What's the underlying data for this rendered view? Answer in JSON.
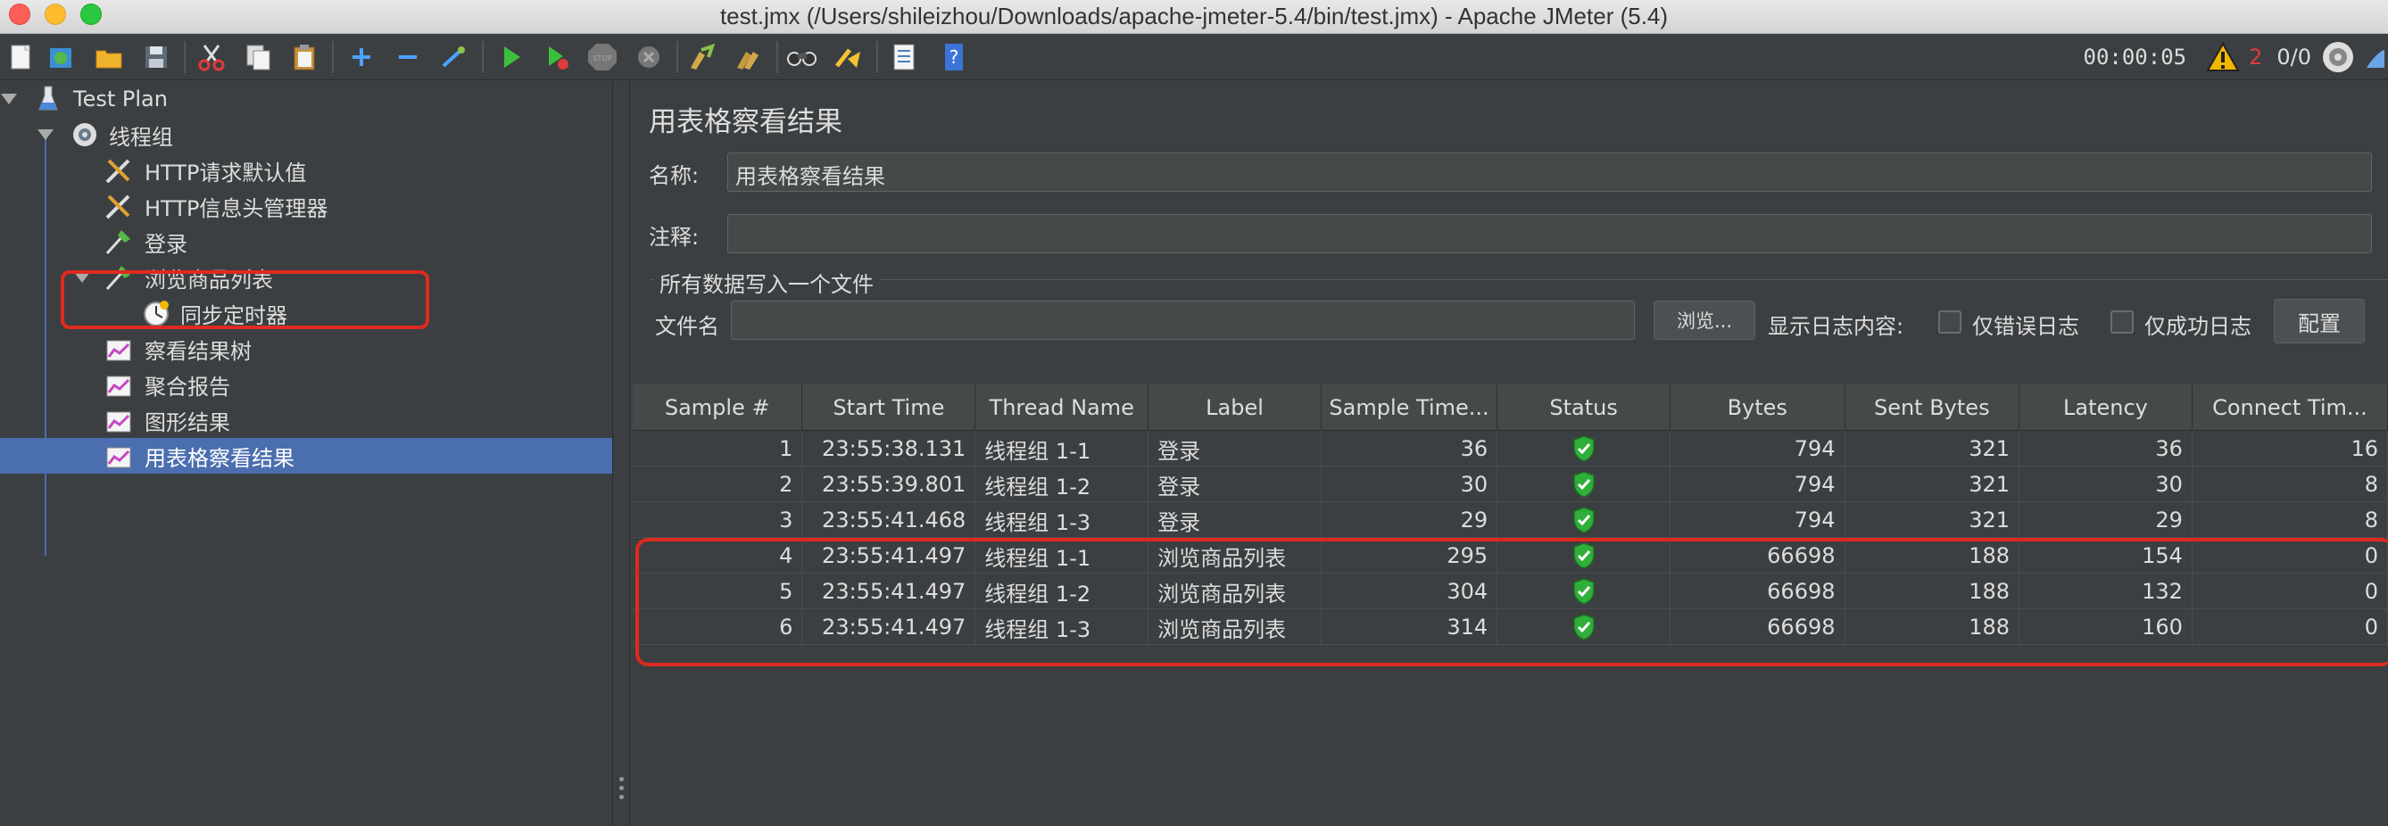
{
  "window": {
    "title": "test.jmx (/Users/shileizhou/Downloads/apache-jmeter-5.4/bin/test.jmx) - Apache JMeter (5.4)"
  },
  "toolbar": {
    "icons": [
      "new-icon",
      "templates-icon",
      "open-icon",
      "save-icon",
      "cut-icon",
      "copy-icon",
      "paste-icon",
      "expand-icon",
      "collapse-icon",
      "toggle-icon",
      "start-icon",
      "start-no-pause-icon",
      "stop-icon",
      "shutdown-icon",
      "clear-icon",
      "clear-all-icon",
      "search-icon",
      "reset-search-icon",
      "function-helper-icon",
      "help-icon"
    ],
    "timer": "00:00:05",
    "warning_count": "2",
    "threads": "0/0"
  },
  "tree": {
    "items": [
      {
        "label": "Test Plan",
        "icon": "test-plan-icon"
      },
      {
        "label": "线程组",
        "icon": "thread-group-icon"
      },
      {
        "label": "HTTP请求默认值",
        "icon": "config-element-icon"
      },
      {
        "label": "HTTP信息头管理器",
        "icon": "config-element-icon"
      },
      {
        "label": "登录",
        "icon": "sampler-icon"
      },
      {
        "label": "浏览商品列表",
        "icon": "sampler-icon"
      },
      {
        "label": "同步定时器",
        "icon": "timer-icon"
      },
      {
        "label": "察看结果树",
        "icon": "listener-icon"
      },
      {
        "label": "聚合报告",
        "icon": "listener-icon"
      },
      {
        "label": "图形结果",
        "icon": "listener-icon"
      },
      {
        "label": "用表格察看结果",
        "icon": "listener-icon"
      }
    ]
  },
  "panel": {
    "title": "用表格察看结果",
    "name_label": "名称:",
    "name_value": "用表格察看结果",
    "comment_label": "注释:",
    "comment_value": "",
    "file_group_label": "所有数据写入一个文件",
    "filename_label": "文件名",
    "filename_value": "",
    "browse_button": "浏览...",
    "log_content_label": "显示日志内容:",
    "errors_only_label": "仅错误日志",
    "success_only_label": "仅成功日志",
    "configure_button": "配置"
  },
  "table": {
    "headers": [
      "Sample #",
      "Start Time",
      "Thread Name",
      "Label",
      "Sample Time...",
      "Status",
      "Bytes",
      "Sent Bytes",
      "Latency",
      "Connect Tim..."
    ],
    "rows": [
      [
        "1",
        "23:55:38.131",
        "线程组 1-1",
        "登录",
        "36",
        "success",
        "794",
        "321",
        "36",
        "16"
      ],
      [
        "2",
        "23:55:39.801",
        "线程组 1-2",
        "登录",
        "30",
        "success",
        "794",
        "321",
        "30",
        "8"
      ],
      [
        "3",
        "23:55:41.468",
        "线程组 1-3",
        "登录",
        "29",
        "success",
        "794",
        "321",
        "29",
        "8"
      ],
      [
        "4",
        "23:55:41.497",
        "线程组 1-1",
        "浏览商品列表",
        "295",
        "success",
        "66698",
        "188",
        "154",
        "0"
      ],
      [
        "5",
        "23:55:41.497",
        "线程组 1-2",
        "浏览商品列表",
        "304",
        "success",
        "66698",
        "188",
        "132",
        "0"
      ],
      [
        "6",
        "23:55:41.497",
        "线程组 1-3",
        "浏览商品列表",
        "314",
        "success",
        "66698",
        "188",
        "160",
        "0"
      ]
    ]
  },
  "colors": {
    "background": "#3c3f41",
    "selection": "#4b6eaf",
    "annotation": "#e0291f",
    "status_ok": "#2fae3a"
  }
}
